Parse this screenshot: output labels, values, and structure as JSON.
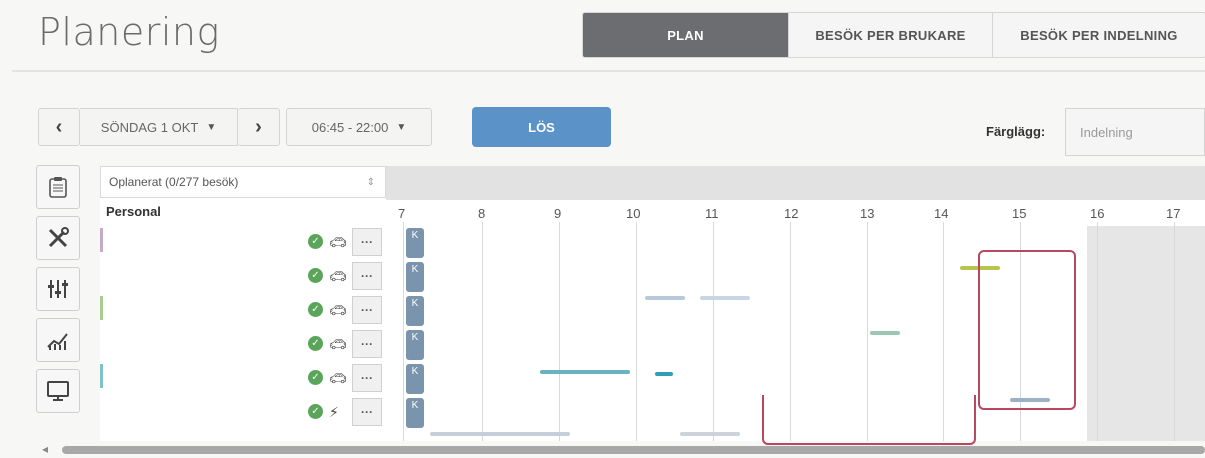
{
  "page": {
    "title": "Planering"
  },
  "tabs": [
    {
      "label": "PLAN",
      "active": true
    },
    {
      "label": "BESÖK PER BRUKARE",
      "active": false
    },
    {
      "label": "BESÖK PER INDELNING",
      "active": false
    }
  ],
  "toolbar": {
    "prev_icon": "‹",
    "date_label": "SÖNDAG 1 OKT",
    "next_icon": "›",
    "time_range": "06:45 - 22:00",
    "solve_label": "LÖS",
    "color_by_label": "Färglägg:",
    "color_by_value": "Indelning"
  },
  "side_icons": [
    "clipboard-icon",
    "tools-icon",
    "sliders-icon",
    "chart-icon",
    "monitor-icon"
  ],
  "planner": {
    "unplanned_label": "Oplanerat (0/277 besök)",
    "personal_header": "Personal",
    "hours": [
      "7",
      "8",
      "9",
      "10",
      "11",
      "12",
      "13",
      "14",
      "15",
      "16",
      "17"
    ],
    "rows": [
      {
        "check": "✓",
        "transport_icon": "car-icon",
        "more": "···",
        "badge": "K"
      },
      {
        "check": "✓",
        "transport_icon": "car-icon",
        "more": "···",
        "badge": "K"
      },
      {
        "check": "✓",
        "transport_icon": "car-icon",
        "more": "···",
        "badge": "K"
      },
      {
        "check": "✓",
        "transport_icon": "car-icon",
        "more": "···",
        "badge": "K"
      },
      {
        "check": "✓",
        "transport_icon": "car-icon",
        "more": "···",
        "badge": "K"
      },
      {
        "check": "✓",
        "transport_icon": "bike-icon",
        "more": "···",
        "badge": "K"
      }
    ]
  },
  "colors": {
    "active_tab": "#6b6d70",
    "solve_button": "#5b92c8",
    "highlight": "#b8475f"
  }
}
